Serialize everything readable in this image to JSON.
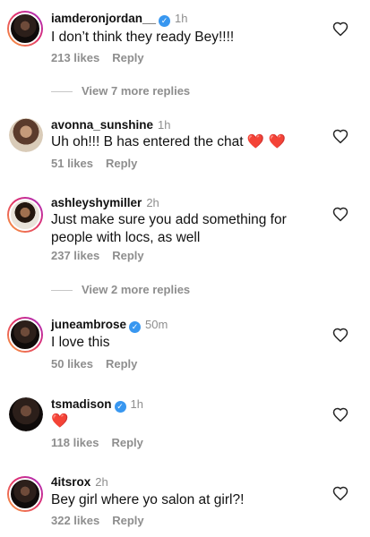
{
  "comments": [
    {
      "username": "iamderonjordan__",
      "verified": true,
      "time": "1h",
      "text": "I don’t think they ready Bey!!!!",
      "likes": "213 likes",
      "reply": "Reply"
    },
    {
      "username": "avonna_sunshine",
      "verified": false,
      "time": "1h",
      "text": "Uh oh!!! B has entered the chat ❤️ ❤️",
      "likes": "51 likes",
      "reply": "Reply"
    },
    {
      "username": "ashleyshymiller",
      "verified": false,
      "time": "2h",
      "text": "Just make sure you add something for people with locs, as well",
      "likes": "237 likes",
      "reply": "Reply"
    },
    {
      "username": "juneambrose",
      "verified": true,
      "time": "50m",
      "text": "I love this",
      "likes": "50 likes",
      "reply": "Reply"
    },
    {
      "username": "tsmadison",
      "verified": true,
      "time": "1h",
      "text": "❤️",
      "likes": "118 likes",
      "reply": "Reply"
    },
    {
      "username": "4itsrox",
      "verified": false,
      "time": "2h",
      "text": "Bey girl where yo salon at girl?!",
      "likes": "322 likes",
      "reply": "Reply"
    }
  ],
  "view_more": [
    {
      "label": "View 7 more replies"
    },
    {
      "label": "View 2 more replies"
    }
  ],
  "icons": {
    "like": "heart-outline-icon",
    "verified": "verified-badge-icon"
  },
  "colors": {
    "text": "#111111",
    "muted": "#8e8e8e",
    "verified": "#3897f0",
    "heart": "#e0245e"
  }
}
